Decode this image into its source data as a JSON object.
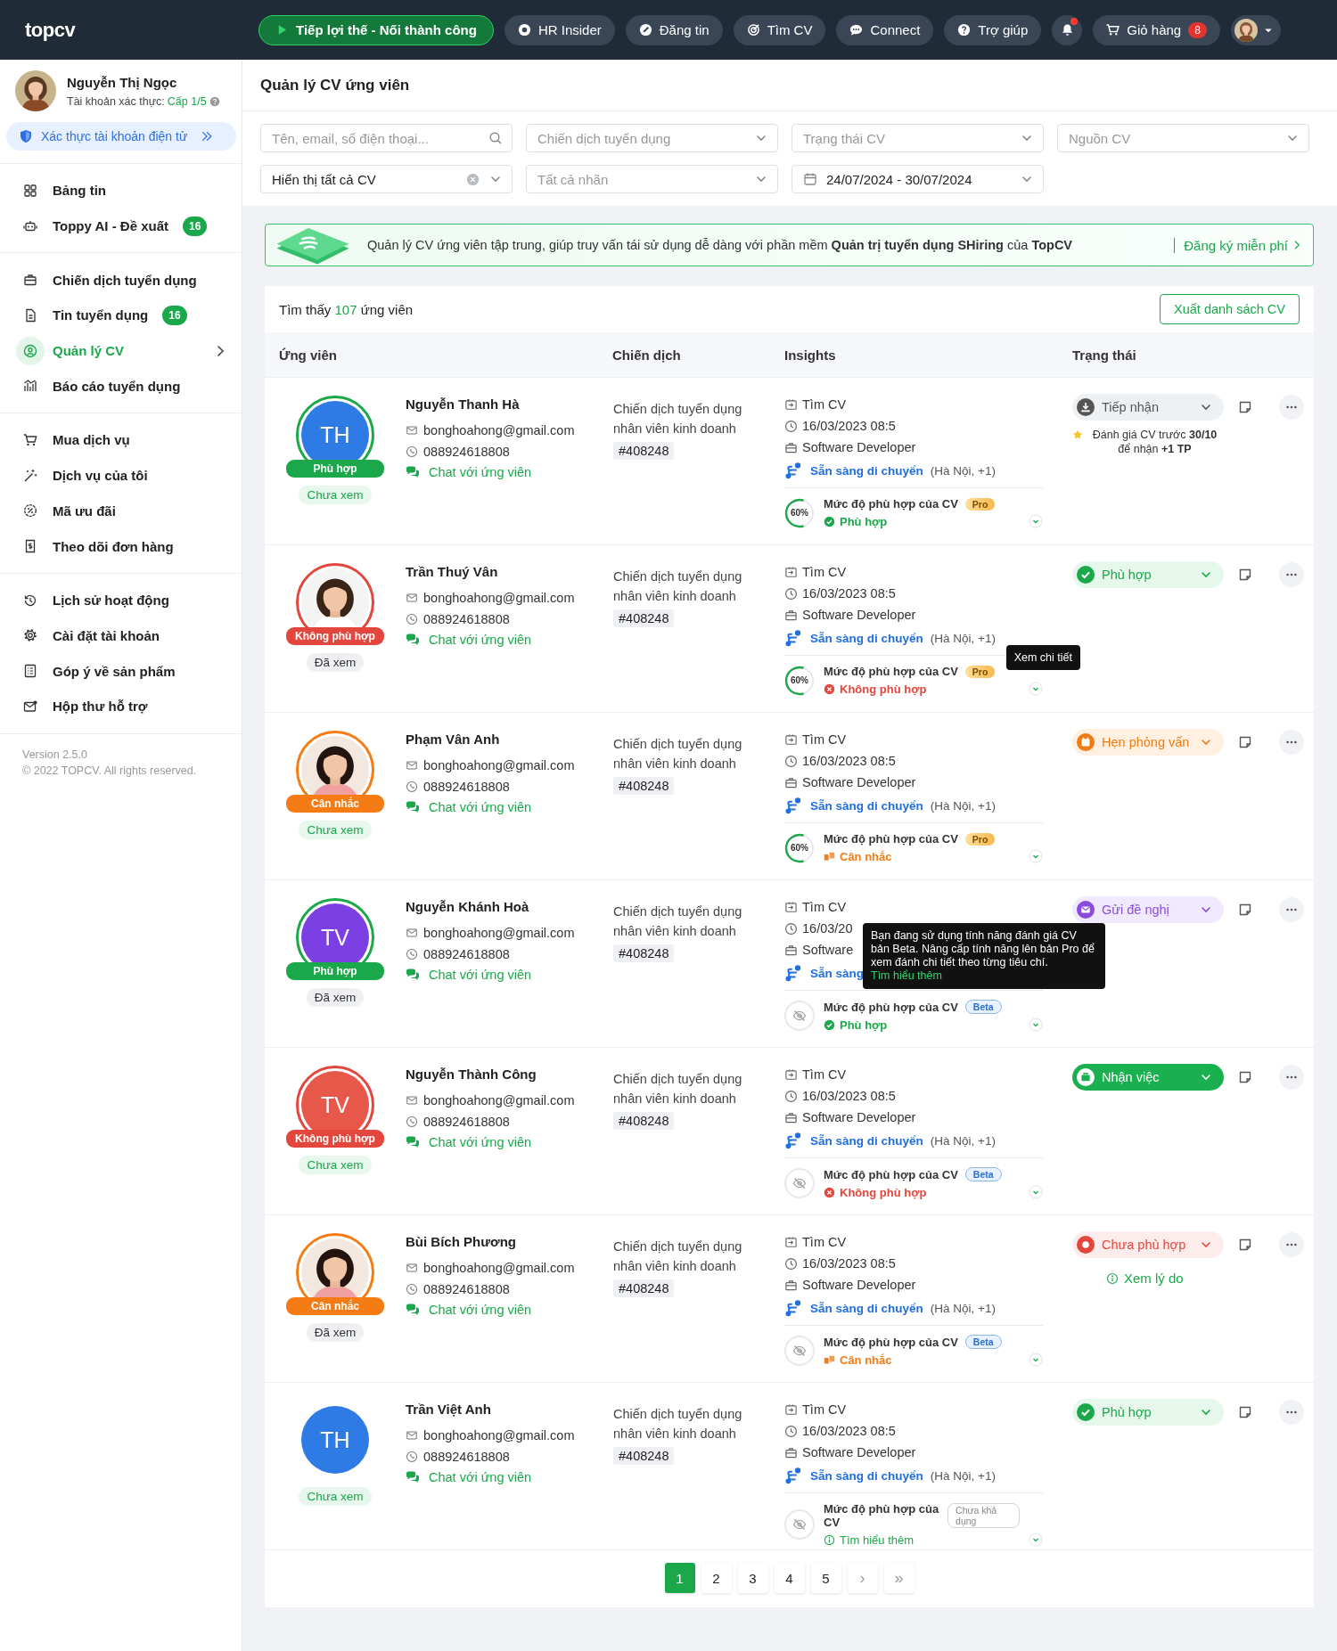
{
  "topbar": {
    "logo": "topcv",
    "nav": [
      {
        "label": "Tiếp lợi thế - Nối thành công",
        "kind": "primary"
      },
      {
        "label": "HR Insider",
        "kind": "normal"
      },
      {
        "label": "Đăng tin",
        "kind": "normal"
      },
      {
        "label": "Tìm CV",
        "kind": "normal"
      },
      {
        "label": "Connect",
        "kind": "normal"
      },
      {
        "label": "Trợ giúp",
        "kind": "normal"
      }
    ],
    "notifications": {
      "unread": true
    },
    "cart": {
      "label": "Giỏ hàng",
      "count": "8"
    }
  },
  "sidebar": {
    "user": {
      "name": "Nguyễn Thị Ngọc",
      "level_label": "Tài khoản xác thực:",
      "level": "Cấp 1/5"
    },
    "verify": "Xác thực tài khoản điện tử",
    "groups": [
      [
        {
          "label": "Bảng tin",
          "selected": false
        },
        {
          "label": "Toppy AI - Đề xuất",
          "badge": "16",
          "selected": false
        }
      ],
      [
        {
          "label": "Chiến dịch tuyển dụng",
          "selected": false
        },
        {
          "label": "Tin tuyển dụng",
          "badge": "16",
          "selected": false
        },
        {
          "label": "Quản lý CV",
          "selected": true
        },
        {
          "label": "Báo cáo tuyển dụng",
          "selected": false
        }
      ],
      [
        {
          "label": "Mua dịch vụ",
          "selected": false
        },
        {
          "label": "Dịch vụ của tôi",
          "selected": false
        },
        {
          "label": "Mã ưu đãi",
          "selected": false
        },
        {
          "label": "Theo dõi đơn hàng",
          "selected": false
        }
      ],
      [
        {
          "label": "Lịch sử hoạt động",
          "selected": false
        },
        {
          "label": "Cài đặt tài khoản",
          "selected": false
        },
        {
          "label": "Góp ý về sản phẩm",
          "selected": false
        },
        {
          "label": "Hộp thư hỗ trợ",
          "selected": false
        }
      ]
    ],
    "version": "Version 2.5.0",
    "copyright": "© 2022 TOPCV. All rights reserved."
  },
  "page_title": "Quản lý CV ứng viên",
  "filters": [
    {
      "kind": "search",
      "placeholder": "Tên, email, số điện thoại..."
    },
    {
      "kind": "select",
      "placeholder": "Chiến dịch tuyển dụng"
    },
    {
      "kind": "select",
      "placeholder": "Trạng thái CV"
    },
    {
      "kind": "select",
      "placeholder": "Nguồn CV"
    },
    {
      "kind": "clearable",
      "value": "Hiển thị tất cả CV"
    },
    {
      "kind": "select",
      "placeholder": "Tất cả nhãn"
    },
    {
      "kind": "date",
      "value": "24/07/2024 - 30/07/2024"
    }
  ],
  "banner": {
    "text": "Quản lý CV ứng viên tập trung, giúp truy vấn tái sử dụng dễ dàng với phần mềm **Quản trị tuyển dụng SHiring** của **TopCV**",
    "link": "Đăng ký miễn phí"
  },
  "results": {
    "prefix": "Tìm thấy",
    "count": "107",
    "suffix": "ứng viên",
    "export": "Xuất danh sách CV"
  },
  "columns": [
    "Ứng viên",
    "Chiến dịch",
    "Insights",
    "Trạng thái"
  ],
  "rows": [
    {
      "name": "Nguyễn Thanh Hà",
      "avatar": {
        "kind": "initials",
        "initials": "TH",
        "color": "#2f7be6"
      },
      "match": {
        "kind": "fit",
        "label": "Phù hợp"
      },
      "viewed": false,
      "viewed_label": "Chưa xem",
      "email": "bonghoahong@gmail.com",
      "phone": "088924618808",
      "chat": "Chat với ứng viên",
      "campaign": "Chiến dịch tuyển dụng nhân viên kinh doanh",
      "code": "#408248",
      "source": "Tìm CV",
      "date": "16/03/2023 08:5",
      "job": "Software Developer",
      "mobility": "Sẵn sàng di chuyển",
      "locations": "(Hà Nội, +1)",
      "score": {
        "kind": "percent",
        "level": 0.6,
        "label": "60%"
      },
      "fit_title": "Mức độ phù hợp của CV",
      "tier": {
        "kind": "pro",
        "label": "Pro"
      },
      "result": {
        "kind": "fit",
        "label": "Phù hợp"
      },
      "status": {
        "kind": "received",
        "label": "Tiếp nhận"
      },
      "note": "Đánh giá CV trước **30/10** để nhận **+1 TP**"
    },
    {
      "name": "Trần Thuý Vân",
      "match": {
        "kind": "unfit",
        "label": "Không phù hợp"
      },
      "viewed": true,
      "viewed_label": "Đã xem",
      "email": "bonghoahong@gmail.com",
      "phone": "088924618808",
      "chat": "Chat với ứng viên",
      "campaign": "Chiến dịch tuyển dụng nhân viên kinh doanh",
      "code": "#408248",
      "source": "Tìm CV",
      "date": "16/03/2023 08:5",
      "job": "Software Developer",
      "mobility": "Sẵn sàng di chuyển",
      "locations": "(Hà Nội, +1)",
      "score": {
        "kind": "percent",
        "level": 0.6,
        "label": "60%"
      },
      "fit_title": "Mức độ phù hợp của CV",
      "tier": {
        "kind": "pro",
        "label": "Pro"
      },
      "result": {
        "kind": "unfit",
        "label": "Không phù hợp"
      },
      "status": {
        "kind": "fit",
        "label": "Phù hợp"
      },
      "tooltip": {
        "kind": "detail",
        "text": "Xem chi tiết"
      }
    },
    {
      "name": "Phạm Vân Anh",
      "match": {
        "kind": "consider",
        "label": "Cân nhắc"
      },
      "viewed": false,
      "viewed_label": "Chưa xem",
      "email": "bonghoahong@gmail.com",
      "phone": "088924618808",
      "chat": "Chat với ứng viên",
      "campaign": "Chiến dịch tuyển dụng nhân viên kinh doanh",
      "code": "#408248",
      "source": "Tìm CV",
      "date": "16/03/2023 08:5",
      "job": "Software Developer",
      "mobility": "Sẵn sàng di chuyển",
      "locations": "(Hà Nội, +1)",
      "score": {
        "kind": "percent",
        "level": 0.6,
        "label": "60%"
      },
      "fit_title": "Mức độ phù hợp của CV",
      "tier": {
        "kind": "pro",
        "label": "Pro"
      },
      "result": {
        "kind": "consider",
        "label": "Cân nhắc"
      },
      "status": {
        "kind": "interview",
        "label": "Hẹn phỏng vấn"
      }
    },
    {
      "name": "Nguyễn Khánh Hoà",
      "avatar": {
        "kind": "initials",
        "initials": "TV",
        "color": "#7b3fe4"
      },
      "match": {
        "kind": "fit",
        "label": "Phù hợp"
      },
      "viewed": true,
      "viewed_label": "Đã xem",
      "email": "bonghoahong@gmail.com",
      "phone": "088924618808",
      "chat": "Chat với ứng viên",
      "campaign": "Chiến dịch tuyển dụng nhân viên kinh doanh",
      "code": "#408248",
      "source": "Tìm CV",
      "date": "16/03/20",
      "job": "Software",
      "mobility": "Sẵn sàng",
      "score": {
        "kind": "hidden"
      },
      "fit_title": "Mức độ phù hợp của CV",
      "tier": {
        "kind": "beta",
        "label": "Beta"
      },
      "result": {
        "kind": "fit",
        "label": "Phù hợp"
      },
      "status": {
        "kind": "offer",
        "label": "Gửi đề nghị"
      },
      "tooltip": {
        "kind": "tier",
        "text": "Bạn đang sử dụng tính năng đánh giá CV bản Beta. Nâng cấp tính năng lên bản Pro để xem đánh chi tiết theo từng tiêu chí.",
        "link": "Tìm hiểu thêm"
      }
    },
    {
      "name": "Nguyễn Thành Công",
      "avatar": {
        "kind": "initials",
        "initials": "TV",
        "color": "#e8584a"
      },
      "match": {
        "kind": "unfit",
        "label": "Không phù hợp"
      },
      "viewed": false,
      "viewed_label": "Chưa xem",
      "email": "bonghoahong@gmail.com",
      "phone": "088924618808",
      "chat": "Chat với ứng viên",
      "campaign": "Chiến dịch tuyển dụng nhân viên kinh doanh",
      "code": "#408248",
      "source": "Tìm CV",
      "date": "16/03/2023 08:5",
      "job": "Software Developer",
      "mobility": "Sẵn sàng di chuyển",
      "locations": "(Hà Nội, +1)",
      "score": {
        "kind": "hidden"
      },
      "fit_title": "Mức độ phù hợp của CV",
      "tier": {
        "kind": "beta",
        "label": "Beta"
      },
      "result": {
        "kind": "unfit",
        "label": "Không phù hợp"
      },
      "status": {
        "kind": "hired",
        "label": "Nhận việc"
      }
    },
    {
      "name": "Bùi Bích Phương",
      "match": {
        "kind": "consider",
        "label": "Cân nhắc"
      },
      "viewed": true,
      "viewed_label": "Đã xem",
      "email": "bonghoahong@gmail.com",
      "phone": "088924618808",
      "chat": "Chat với ứng viên",
      "campaign": "Chiến dịch tuyển dụng nhân viên kinh doanh",
      "code": "#408248",
      "source": "Tìm CV",
      "date": "16/03/2023 08:5",
      "job": "Software Developer",
      "mobility": "Sẵn sàng di chuyển",
      "locations": "(Hà Nội, +1)",
      "score": {
        "kind": "hidden"
      },
      "fit_title": "Mức độ phù hợp của CV",
      "tier": {
        "kind": "beta",
        "label": "Beta"
      },
      "result": {
        "kind": "consider",
        "label": "Cân nhắc"
      },
      "status": {
        "kind": "rejected",
        "label": "Chưa phù hợp"
      },
      "reason_link": "Xem lý do"
    },
    {
      "name": "Trần Việt Anh",
      "avatar": {
        "kind": "initials",
        "initials": "TH",
        "color": "#2f7be6"
      },
      "viewed": false,
      "viewed_label": "Chưa xem",
      "email": "bonghoahong@gmail.com",
      "phone": "088924618808",
      "chat": "Chat với ứng viên",
      "campaign": "Chiến dịch tuyển dụng nhân viên kinh doanh",
      "code": "#408248",
      "source": "Tìm CV",
      "date": "16/03/2023 08:5",
      "job": "Software Developer",
      "mobility": "Sẵn sàng di chuyển",
      "locations": "(Hà Nội, +1)",
      "score": {
        "kind": "hidden"
      },
      "fit_title": "Mức độ phù hợp của CV",
      "tier": {
        "kind": "unavailable",
        "label": "Chưa khả dụng"
      },
      "result": {
        "kind": "info",
        "label": "Tìm hiểu thêm"
      },
      "status": {
        "kind": "fit",
        "label": "Phù hợp"
      }
    }
  ],
  "pagination": {
    "pages": [
      {
        "label": "1",
        "selected": true
      },
      {
        "label": "2",
        "selected": false
      },
      {
        "label": "3",
        "selected": false
      },
      {
        "label": "4",
        "selected": false
      },
      {
        "label": "5",
        "selected": false
      }
    ],
    "next": "›",
    "last": "»"
  }
}
